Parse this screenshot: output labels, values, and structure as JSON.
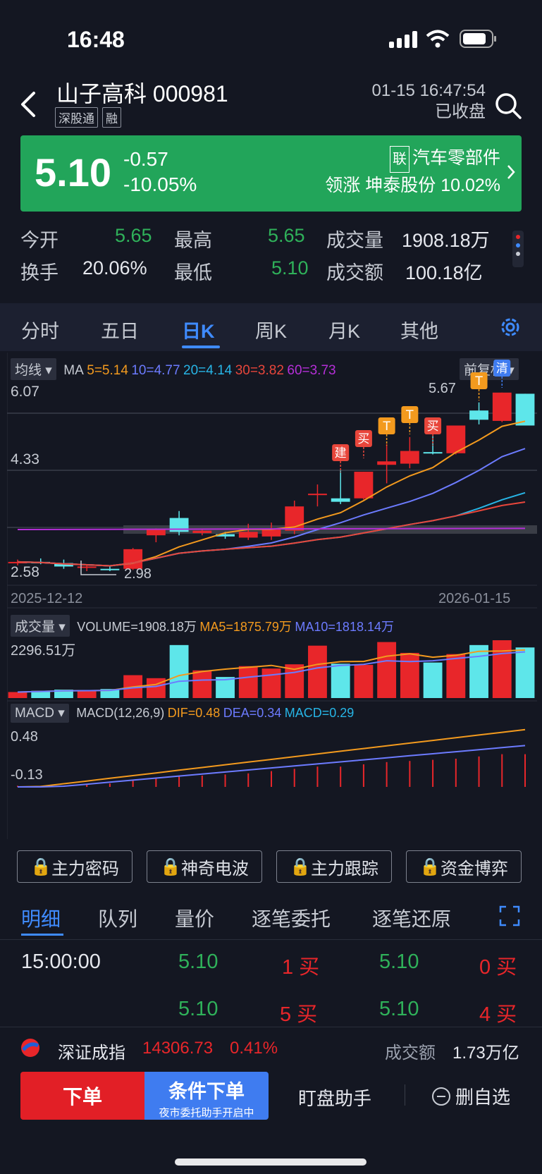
{
  "status_bar": {
    "time": "16:48"
  },
  "header": {
    "stock_name": "山子高科",
    "stock_code": "000981",
    "badges": [
      "深股通",
      "融"
    ],
    "datetime": "01-15 16:47:54",
    "market_status": "已收盘"
  },
  "quote": {
    "price": "5.10",
    "change": "-0.57",
    "change_pct": "-10.05%",
    "sector_tag": "联",
    "sector": "汽车零部件",
    "leader_label": "领涨",
    "leader_name": "坤泰股份",
    "leader_pct": "10.02%"
  },
  "stats": {
    "open_label": "今开",
    "open": "5.65",
    "high_label": "最高",
    "high": "5.65",
    "volume_label": "成交量",
    "volume": "1908.18万",
    "turnover_label": "换手",
    "turnover": "20.06%",
    "low_label": "最低",
    "low": "5.10",
    "amount_label": "成交额",
    "amount": "100.18亿"
  },
  "tabs": [
    "分时",
    "五日",
    "日K",
    "周K",
    "月K",
    "其他"
  ],
  "active_tab": "日K",
  "kline": {
    "ma_button": "均线",
    "ma_label": "MA",
    "ma5": "5=5.14",
    "ma10": "10=4.77",
    "ma20": "20=4.14",
    "ma30": "30=3.82",
    "ma60": "60=3.73",
    "adjust_button": "前复权",
    "y_top": "6.07",
    "y_mid": "4.33",
    "y_bottom": "2.58",
    "max_label": "5.67",
    "min_label": "2.98",
    "date_start": "2025-12-12",
    "date_end": "2026-01-15",
    "signals": [
      "建",
      "买",
      "T",
      "T",
      "买",
      "T",
      "清"
    ]
  },
  "volume": {
    "button": "成交量",
    "value": "VOLUME=1908.18万",
    "ma5": "MA5=1875.79万",
    "ma10": "MA10=1818.14万",
    "y_top": "2296.51万"
  },
  "macd": {
    "button": "MACD",
    "params": "MACD(12,26,9)",
    "dif": "DIF=0.48",
    "dea": "DEA=0.34",
    "macd": "MACD=0.29",
    "y_top": "0.48",
    "y_bottom": "-0.13"
  },
  "chart_data": {
    "type": "candlestick",
    "x_range": [
      "2025-12-12",
      "2026-01-15"
    ],
    "ylim": [
      2.58,
      6.07
    ],
    "candles": [
      {
        "o": 2.72,
        "h": 2.78,
        "l": 2.68,
        "c": 2.74,
        "dir": "up"
      },
      {
        "o": 2.74,
        "h": 2.8,
        "l": 2.7,
        "c": 2.72,
        "dir": "down"
      },
      {
        "o": 2.72,
        "h": 2.78,
        "l": 2.62,
        "c": 2.66,
        "dir": "down"
      },
      {
        "o": 2.66,
        "h": 2.7,
        "l": 2.58,
        "c": 2.64,
        "dir": "up"
      },
      {
        "o": 2.62,
        "h": 2.66,
        "l": 2.58,
        "c": 2.6,
        "dir": "down"
      },
      {
        "o": 2.62,
        "h": 2.98,
        "l": 2.6,
        "c": 2.96,
        "dir": "up"
      },
      {
        "o": 3.2,
        "h": 3.32,
        "l": 3.08,
        "c": 3.3,
        "dir": "up"
      },
      {
        "o": 3.26,
        "h": 3.62,
        "l": 3.2,
        "c": 3.5,
        "dir": "down"
      },
      {
        "o": 3.28,
        "h": 3.3,
        "l": 3.2,
        "c": 3.24,
        "dir": "up"
      },
      {
        "o": 3.18,
        "h": 3.26,
        "l": 3.14,
        "c": 3.22,
        "dir": "down"
      },
      {
        "o": 3.16,
        "h": 3.4,
        "l": 3.12,
        "c": 3.26,
        "dir": "up"
      },
      {
        "o": 3.18,
        "h": 3.42,
        "l": 3.12,
        "c": 3.3,
        "dir": "up"
      },
      {
        "o": 3.28,
        "h": 3.8,
        "l": 3.22,
        "c": 3.7,
        "dir": "up"
      },
      {
        "o": 3.92,
        "h": 4.08,
        "l": 3.7,
        "c": 3.92,
        "dir": "up"
      },
      {
        "o": 3.84,
        "h": 4.32,
        "l": 3.74,
        "c": 3.78,
        "dir": "down"
      },
      {
        "o": 3.84,
        "h": 4.3,
        "l": 3.82,
        "c": 4.3,
        "dir": "up"
      },
      {
        "o": 4.42,
        "h": 4.78,
        "l": 4.1,
        "c": 4.48,
        "dir": "up"
      },
      {
        "o": 4.44,
        "h": 4.9,
        "l": 4.36,
        "c": 4.66,
        "dir": "up"
      },
      {
        "o": 4.64,
        "h": 4.92,
        "l": 4.6,
        "c": 4.64,
        "dir": "down"
      },
      {
        "o": 4.62,
        "h": 5.1,
        "l": 4.6,
        "c": 5.1,
        "dir": "up"
      },
      {
        "o": 5.2,
        "h": 5.5,
        "l": 5.12,
        "c": 5.36,
        "dir": "down"
      },
      {
        "o": 5.18,
        "h": 5.67,
        "l": 5.16,
        "c": 5.67,
        "dir": "up"
      },
      {
        "o": 5.65,
        "h": 5.65,
        "l": 5.1,
        "c": 5.1,
        "dir": "down"
      }
    ],
    "volume": [
      1,
      1.2,
      1.4,
      1.3,
      1.5,
      3.8,
      3.3,
      8.8,
      4.6,
      3.5,
      5.3,
      4.9,
      5.6,
      8.7,
      5.7,
      5.5,
      9.3,
      7.5,
      5.9,
      7.3,
      8.8,
      9.6,
      8.4
    ],
    "volume_max": "2296.51万",
    "macd_bars": [
      0.01,
      0.01,
      0.01,
      0.02,
      0.03,
      0.06,
      0.08,
      0.1,
      0.1,
      0.11,
      0.12,
      0.14,
      0.16,
      0.18,
      0.18,
      0.2,
      0.22,
      0.23,
      0.24,
      0.25,
      0.27,
      0.29,
      0.29
    ]
  },
  "features": [
    "主力密码",
    "神奇电波",
    "主力跟踪",
    "资金博弈"
  ],
  "detail_tabs": [
    "明细",
    "队列",
    "量价",
    "逐笔委托",
    "逐笔还原"
  ],
  "trades": [
    {
      "time": "15:00:00",
      "p1": "5.10",
      "v1": "1 买",
      "p2": "5.10",
      "v2": "0 买"
    },
    {
      "time": "",
      "p1": "5.10",
      "v1": "5 买",
      "p2": "5.10",
      "v2": "4 买"
    }
  ],
  "index_bar": {
    "name": "深证成指",
    "value": "14306.73",
    "pct": "0.41%",
    "amount_label": "成交额",
    "amount": "1.73万亿"
  },
  "actions": {
    "order": "下单",
    "cond_order": "条件下单",
    "cond_sub": "夜市委托助手开启中",
    "assistant": "盯盘助手",
    "remove_fav": "删自选"
  },
  "colors": {
    "up": "#e8262a",
    "down": "#5ee6ea",
    "green": "#2fb15a",
    "accent": "#3f8bff",
    "banner": "#22a55a"
  }
}
